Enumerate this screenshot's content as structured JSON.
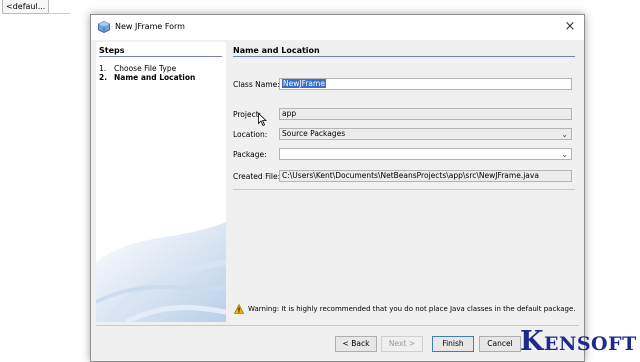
{
  "ide": {
    "tab_label": "<defaul...",
    "minimize_glyph": "—"
  },
  "dialog": {
    "title": "New JFrame Form",
    "close_glyph": "×"
  },
  "steps": {
    "heading": "Steps",
    "items": [
      {
        "number": "1.",
        "label": "Choose File Type",
        "current": false
      },
      {
        "number": "2.",
        "label": "Name and Location",
        "current": true
      }
    ]
  },
  "main": {
    "heading": "Name and Location",
    "class_name": {
      "label": "Class Name:",
      "value": "NewJFrame"
    },
    "project": {
      "label": "Project:",
      "value": "app"
    },
    "location": {
      "label": "Location:",
      "value": "Source Packages"
    },
    "package": {
      "label": "Package:",
      "value": ""
    },
    "created_file": {
      "label": "Created File:",
      "value": "C:\\Users\\Kent\\Documents\\NetBeansProjects\\app\\src\\NewJFrame.java"
    },
    "warning": "Warning: It is highly recommended that you do not place Java classes in the default package."
  },
  "buttons": {
    "back": "< Back",
    "next": "Next >",
    "finish": "Finish",
    "cancel": "Cancel"
  },
  "watermark": {
    "first_letter": "K",
    "rest": "ENSOFT"
  },
  "colors": {
    "selection": "#3a6fc9",
    "rule": "#6b87b5",
    "dialog_bg": "#f0f0f0",
    "logo": "#1c2a8f",
    "warning": "#e8b400"
  }
}
